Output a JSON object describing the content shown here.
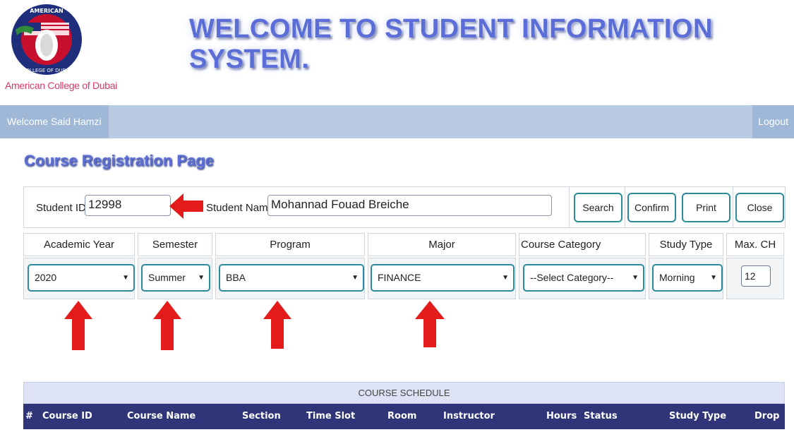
{
  "header": {
    "college_name": "American College of Dubai",
    "banner_title": "WELCOME TO STUDENT INFORMATION SYSTEM."
  },
  "nav": {
    "welcome": "Welcome Said Hamzi",
    "logout": "Logout"
  },
  "page_title": "Course Registration Page",
  "student": {
    "id_label": "Student ID:",
    "id_value": "12998",
    "name_label": "Student Name:",
    "name_value": "Mohannad  Fouad  Breiche"
  },
  "actions": {
    "search": "Search",
    "confirm": "Confirm",
    "print": "Print",
    "close": "Close"
  },
  "filters": {
    "headers": [
      "Academic Year",
      "Semester",
      "Program",
      "Major",
      "Course Category",
      "Study Type",
      "Max. CH"
    ],
    "academic_year": "2020",
    "semester": "Summer",
    "program": "BBA",
    "major": "FINANCE",
    "course_category": "--Select Category--",
    "study_type": "Morning",
    "max_ch": "12"
  },
  "schedule": {
    "caption": "COURSE SCHEDULE",
    "columns": [
      "#",
      "Course ID",
      "Course Name",
      "Section",
      "Time Slot",
      "Room",
      "Instructor",
      "Hours",
      "Status",
      "Study Type",
      "Drop"
    ]
  },
  "colors": {
    "accent_teal": "#2b8a9c",
    "nav_bg": "#b8cbe3",
    "table_header": "#2f3578",
    "arrow_red": "#e31b1b"
  }
}
